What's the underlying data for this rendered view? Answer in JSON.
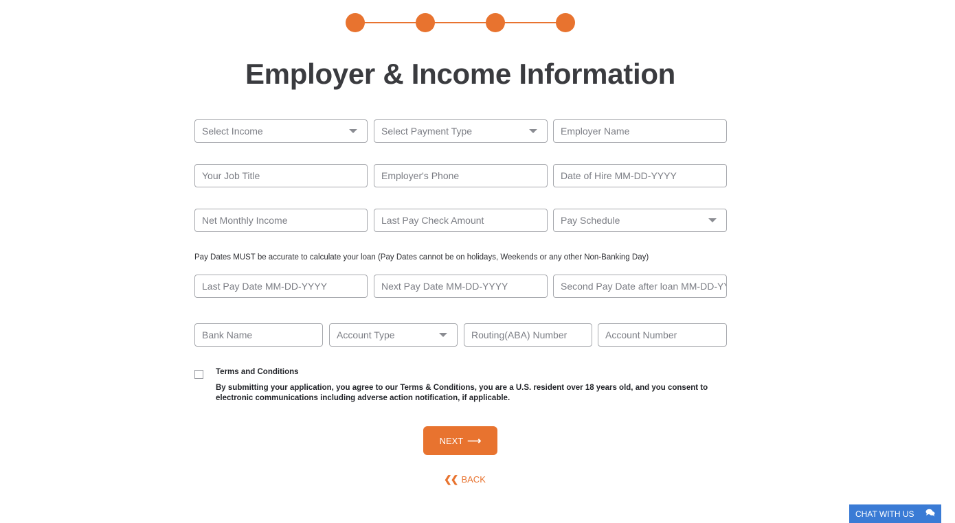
{
  "progress": {
    "steps_total": 4,
    "steps_completed": 4,
    "accent_color": "#e8732f"
  },
  "page": {
    "title": "Employer & Income Information"
  },
  "form": {
    "row1": {
      "select_income": {
        "placeholder": "Select Income"
      },
      "select_payment_type": {
        "placeholder": "Select Payment Type"
      },
      "employer_name": {
        "placeholder": "Employer Name"
      }
    },
    "row2": {
      "job_title": {
        "placeholder": "Your Job Title"
      },
      "employer_phone": {
        "placeholder": "Employer's Phone"
      },
      "date_of_hire": {
        "placeholder": "Date of Hire MM-DD-YYYY"
      }
    },
    "row3": {
      "net_monthly_income": {
        "placeholder": "Net Monthly Income"
      },
      "last_pay_check_amount": {
        "placeholder": "Last Pay Check Amount"
      },
      "pay_schedule": {
        "placeholder": "Pay Schedule"
      }
    },
    "pay_dates_note": "Pay Dates MUST be accurate to calculate your loan (Pay Dates cannot be on holidays, Weekends or any other Non-Banking Day)",
    "row4": {
      "last_pay_date": {
        "placeholder": "Last Pay Date MM-DD-YYYY"
      },
      "next_pay_date": {
        "placeholder": "Next Pay Date MM-DD-YYYY"
      },
      "second_pay_date": {
        "placeholder": "Second Pay Date after loan MM-DD-YYYY"
      }
    },
    "row5": {
      "bank_name": {
        "placeholder": "Bank Name"
      },
      "account_type": {
        "placeholder": "Account Type"
      },
      "routing_number": {
        "placeholder": "Routing(ABA) Number"
      },
      "account_number": {
        "placeholder": "Account Number"
      }
    },
    "terms": {
      "checked": false,
      "title": "Terms and Conditions",
      "body": "By submitting your application, you agree to our Terms & Conditions, you are a U.S. resident over 18 years old, and you consent to electronic communications including adverse action notification, if applicable."
    }
  },
  "actions": {
    "next_label": "NEXT",
    "next_icon": "arrow-right-icon",
    "back_label": "BACK",
    "back_icon": "double-chevron-left-icon"
  },
  "chat": {
    "label": "CHAT WITH US",
    "icon": "chat-bubbles-icon",
    "color": "#3a7bd5"
  }
}
